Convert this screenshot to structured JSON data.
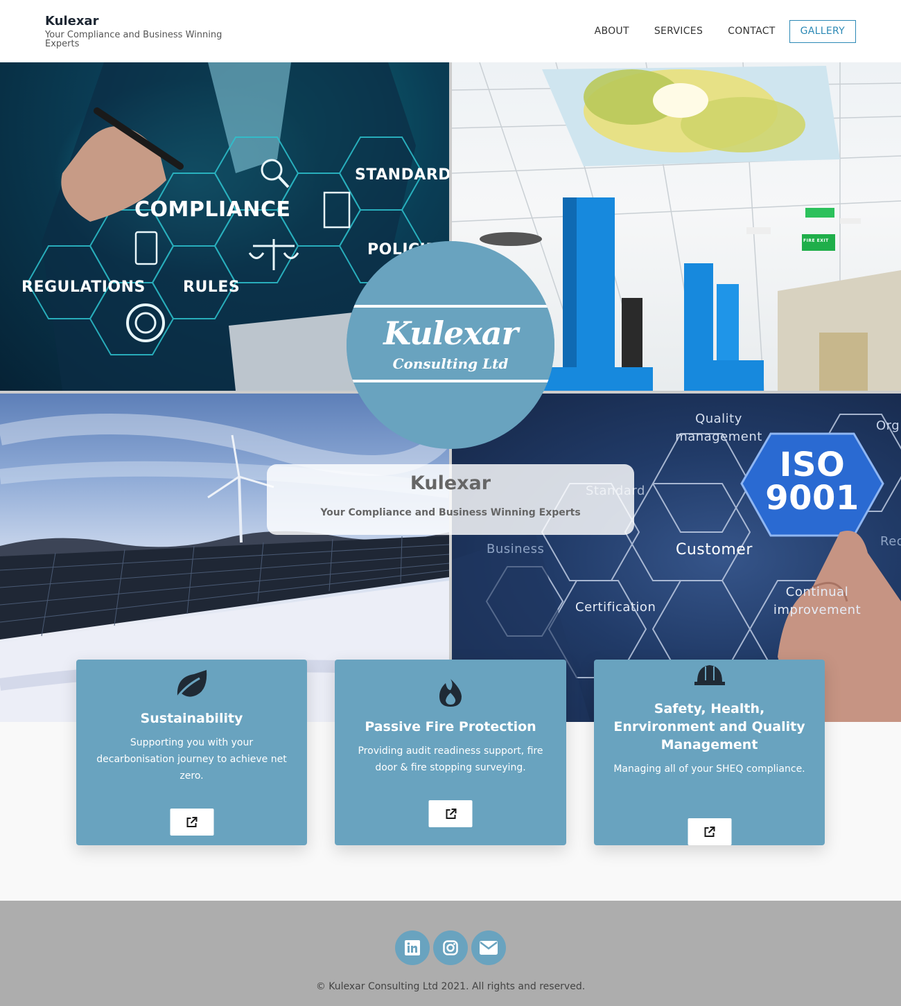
{
  "header": {
    "brand_title": "Kulexar",
    "brand_tagline": "Your Compliance and Business Winning Experts",
    "nav": [
      {
        "label": "ABOUT"
      },
      {
        "label": "SERVICES"
      },
      {
        "label": "CONTACT"
      }
    ],
    "gallery_button": "GALLERY",
    "accent_color": "#2c89b5"
  },
  "hero": {
    "images": {
      "compliance": {
        "words": [
          "COMPLIANCE",
          "STANDARDS",
          "POLICIES",
          "REGULATIONS",
          "RULES"
        ]
      },
      "iso": {
        "words": [
          "Quality management",
          "Standard",
          "Business",
          "Customer",
          "Certification",
          "Continual improvement",
          "Org",
          "Req"
        ],
        "badge_line1": "ISO",
        "badge_line2": "9001"
      },
      "office_signs": [
        "FIRE EXIT"
      ]
    },
    "logo": {
      "name": "Kulexar",
      "subtitle": "Consulting Ltd",
      "color": "#69a3bf"
    },
    "title": "Kulexar",
    "subtitle": "Your Compliance and Business Winning Experts"
  },
  "services": [
    {
      "icon": "leaf-icon",
      "title": "Sustainability",
      "description": "Supporting you with your decarbonisation journey to achieve net zero."
    },
    {
      "icon": "fire-icon",
      "title": "Passive Fire Protection",
      "description": "Providing audit readiness support, fire door & fire stopping surveying."
    },
    {
      "icon": "hard-hat-icon",
      "title": "Safety, Health, Enrvironment and Quality Management",
      "description": "Managing all of your SHEQ compliance."
    }
  ],
  "card_color": "#69a3bf",
  "footer": {
    "social": [
      "linkedin-icon",
      "instagram-icon",
      "envelope-icon"
    ],
    "copyright": "© Kulexar Consulting Ltd 2021. All rights and reserved."
  }
}
